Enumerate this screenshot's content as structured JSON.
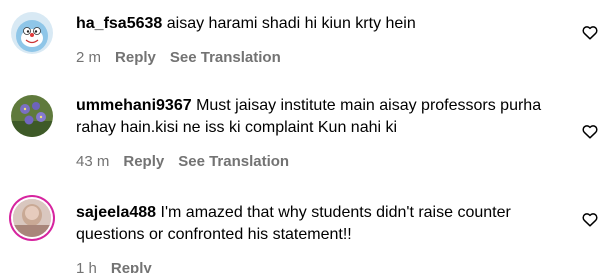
{
  "comments": [
    {
      "username": "ha_fsa5638",
      "text": "aisay harami shadi hi kiun krty hein",
      "time": "2 m",
      "reply_label": "Reply",
      "translation_label": "See Translation",
      "avatar_icon": "cartoon-avatar"
    },
    {
      "username": "ummehani9367",
      "text": "Must jaisay institute main aisay professors purha rahay hain.kisi ne iss ki complaint Kun nahi ki",
      "time": "43 m",
      "reply_label": "Reply",
      "translation_label": "See Translation",
      "avatar_icon": "flower-avatar"
    },
    {
      "username": "sajeela488",
      "text": "I'm amazed that why students didn't raise counter questions or confronted his statement!!",
      "time": "1 h",
      "reply_label": "Reply",
      "avatar_icon": "photo-avatar"
    }
  ],
  "icons": {
    "like": "heart-outline-icon"
  },
  "colors": {
    "meta_text": "#737373",
    "story_ring": "#d6249f"
  }
}
